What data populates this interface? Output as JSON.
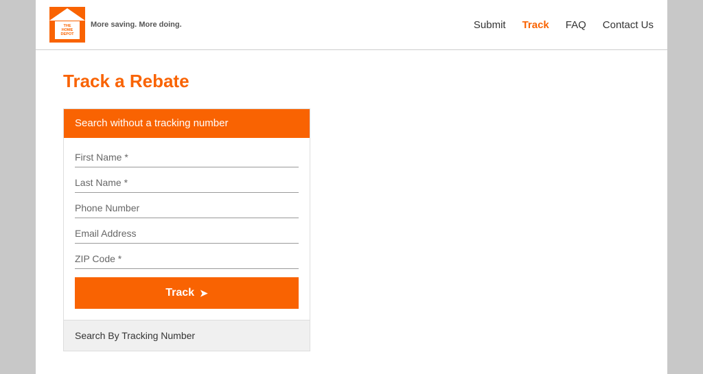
{
  "header": {
    "logo": {
      "line1": "THE",
      "line2": "HOME",
      "line3": "DEPOT"
    },
    "tagline": {
      "part1": "More saving.",
      "part2": "More doing."
    },
    "nav": {
      "submit": "Submit",
      "track": "Track",
      "faq": "FAQ",
      "contact": "Contact Us"
    }
  },
  "main": {
    "page_title": "Track a Rebate",
    "form": {
      "section_title": "Search without a tracking number",
      "fields": {
        "first_name_placeholder": "First Name *",
        "last_name_placeholder": "Last Name *",
        "phone_placeholder": "Phone Number",
        "email_placeholder": "Email Address",
        "zip_placeholder": "ZIP Code *"
      },
      "track_button": "Track",
      "footer_label": "Search By Tracking Number"
    }
  }
}
